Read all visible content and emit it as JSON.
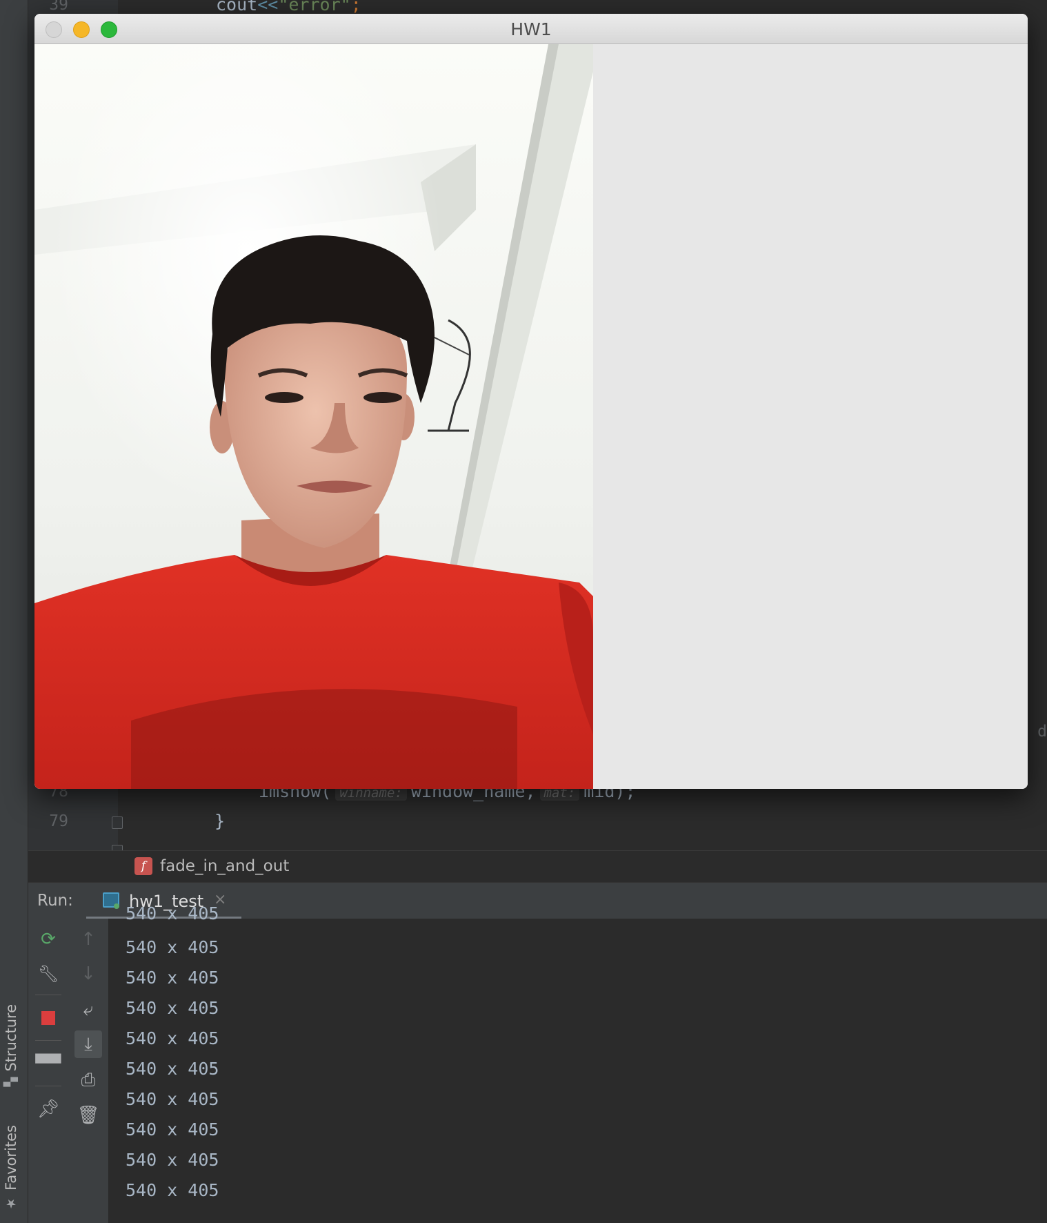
{
  "side_tabs": {
    "structure": "Structure",
    "favorites": "Favorites"
  },
  "editor": {
    "top_line": {
      "number": "39",
      "code_ident": "cout",
      "code_op": "<<",
      "code_str": "\"error\"",
      "code_end": ";"
    },
    "line78": {
      "number": "78",
      "fn": "imshow(",
      "hint1": "winname:",
      "arg1": "window_name,",
      "hint2": "mat:",
      "arg2": "mid);"
    },
    "line79": {
      "number": "79",
      "code": "}"
    },
    "right_edge_char": "d"
  },
  "breadcrumb": {
    "icon_letter": "f",
    "function_name": "fade_in_and_out"
  },
  "run": {
    "label": "Run:",
    "tab_label": "hw1_test",
    "close_glyph": "×"
  },
  "console": {
    "lines": [
      "540 x 405",
      "540 x 405",
      "540 x 405",
      "540 x 405",
      "540 x 405",
      "540 x 405",
      "540 x 405",
      "540 x 405",
      "540 x 405",
      "540 x 405"
    ]
  },
  "window": {
    "title": "HW1",
    "traffic_lights": {
      "close": "#d0d0d0",
      "minimize": "#f5b728",
      "zoom": "#2cb83c"
    }
  },
  "colors": {
    "shirt": "#d42a20",
    "stop": "#db3e3e",
    "rerun": "#59a869"
  },
  "icons": {
    "toolbar1": [
      "rerun-icon",
      "wrench-icon",
      "stop-icon",
      "layout-icon",
      "pin-icon"
    ],
    "toolbar2": [
      "arrow-up-icon",
      "arrow-down-icon",
      "soft-wrap-icon",
      "scroll-to-end-icon",
      "print-icon",
      "trash-icon"
    ]
  }
}
